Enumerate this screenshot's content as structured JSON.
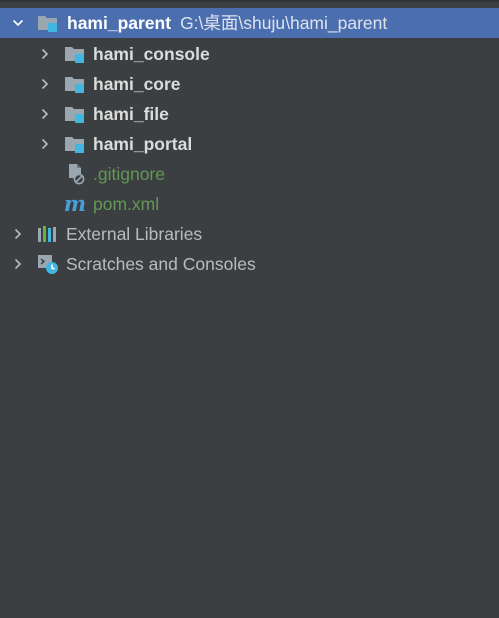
{
  "tree": {
    "root": {
      "label": "hami_parent",
      "path": "G:\\桌面\\shuju\\hami_parent",
      "expanded": true,
      "icon": "module-folder-icon"
    },
    "children": [
      {
        "label": "hami_console",
        "icon": "module-folder-icon",
        "expanded": false
      },
      {
        "label": "hami_core",
        "icon": "module-folder-icon",
        "expanded": false
      },
      {
        "label": "hami_file",
        "icon": "module-folder-icon",
        "expanded": false
      },
      {
        "label": "hami_portal",
        "icon": "module-folder-icon",
        "expanded": false
      },
      {
        "label": ".gitignore",
        "icon": "ignored-file-icon",
        "color": "#629755"
      },
      {
        "label": "pom.xml",
        "icon": "maven-icon",
        "icon_glyph": "m",
        "color": "#629755"
      }
    ],
    "top_level": [
      {
        "label": "External Libraries",
        "icon": "libraries-icon",
        "expanded": false
      },
      {
        "label": "Scratches and Consoles",
        "icon": "scratches-icon",
        "expanded": false
      }
    ]
  },
  "colors": {
    "background": "#3c3f41",
    "selection": "#4b6eaf",
    "text": "#bbbbbb",
    "vcs_added": "#629755",
    "accent_blue": "#40b6e0"
  }
}
